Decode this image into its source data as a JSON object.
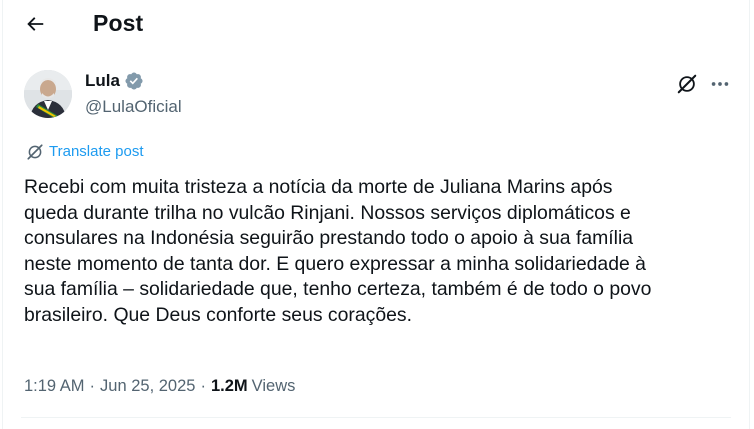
{
  "header": {
    "title": "Post"
  },
  "author": {
    "name": "Lula",
    "handle": "@LulaOficial"
  },
  "translate": {
    "label": "Translate post"
  },
  "post": {
    "text": "Recebi com muita tristeza a notícia da morte de Juliana Marins após\nqueda durante trilha no vulcão Rinjani. Nossos serviços diplomáticos e\nconsulares na Indonésia seguirão prestando todo o apoio à sua família\nneste momento de tanta dor. E quero expressar a minha solidariedade à\nsua família – solidariedade que, tenho certeza, também é de todo o povo\nbrasileiro. Que Deus conforte seus corações."
  },
  "meta": {
    "time": "1:19 AM",
    "date": "Jun 25, 2025",
    "views_count": "1.2M",
    "views_label": "Views",
    "separator": "·"
  },
  "colors": {
    "accent": "#1d9bf0",
    "secondary_text": "#536471",
    "primary_text": "#0f1419"
  },
  "icons": {
    "back": "arrow-left-icon",
    "verified": "verified-badge-icon",
    "grok": "grok-icon",
    "more": "more-horizontal-icon",
    "translate": "translate-icon"
  }
}
